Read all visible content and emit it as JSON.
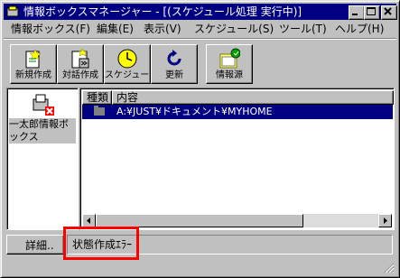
{
  "window": {
    "title": "情報ボックスマネージャー - [(スケジュール処理  実行中)]",
    "controls": [
      "minimize-icon",
      "maximize-icon",
      "close-icon"
    ]
  },
  "menu": [
    {
      "label": "情報ボックス(F)"
    },
    {
      "label": "編集(E)"
    },
    {
      "label": "表示(V)"
    },
    {
      "label": "スケジュール(S)"
    },
    {
      "label": "ツール(T)"
    },
    {
      "label": "ヘルプ(H)"
    }
  ],
  "toolbar": {
    "new": {
      "label": "新規作成",
      "icon": "new-doc-icon"
    },
    "dialog": {
      "label": "対話作成",
      "icon": "dialog-create-icon"
    },
    "schedule": {
      "label": "スケジュール",
      "icon": "clock-icon"
    },
    "update": {
      "label": "更新",
      "icon": "refresh-icon"
    },
    "source": {
      "label": "情報源",
      "icon": "info-source-icon"
    }
  },
  "left_pane": {
    "account_label": "一太郎情報ボックス",
    "icon": "mailbox-error-icon"
  },
  "list": {
    "columns": [
      "種類",
      "内容"
    ],
    "rows": [
      {
        "type_icon": "folder-icon",
        "content": "A:¥JUST¥ドキュメント¥MYHOME"
      }
    ]
  },
  "details_button": "詳細..",
  "status_text": "状態作成ｴﾗｰ",
  "colors": {
    "titlebar": "#000080",
    "selection": "#000080",
    "highlight": "#ff0000",
    "face": "#c0c0c0"
  }
}
